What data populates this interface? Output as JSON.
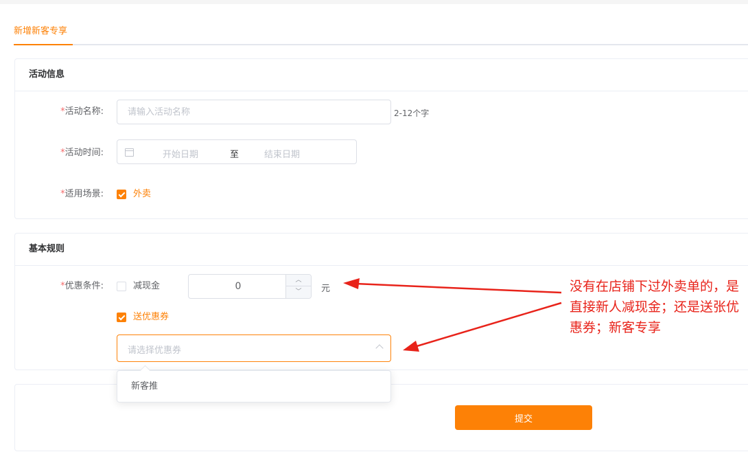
{
  "tabs": {
    "active_label": "新增新客专享"
  },
  "section_activity": {
    "title": "活动信息",
    "name_field": {
      "required_mark": "*",
      "label": "活动名称:",
      "placeholder": "请输入活动名称",
      "hint": "2-12个字"
    },
    "time_field": {
      "required_mark": "*",
      "label": "活动时间:",
      "start_placeholder": "开始日期",
      "separator": "至",
      "end_placeholder": "结束日期"
    },
    "scene_field": {
      "required_mark": "*",
      "label": "适用场景:",
      "option_label": "外卖",
      "checked": true
    }
  },
  "section_rules": {
    "title": "基本规则",
    "discount_field": {
      "required_mark": "*",
      "label": "优惠条件:",
      "cash_option": {
        "label": "减现金",
        "checked": false
      },
      "cash_value": "0",
      "unit": "元",
      "coupon_option": {
        "label": "送优惠券",
        "checked": true
      },
      "coupon_select_placeholder": "请选择优惠券",
      "coupon_options": [
        "新客推"
      ]
    }
  },
  "actions": {
    "submit_label": "提交"
  },
  "annotation": {
    "text": "没有在店铺下过外卖单的，是直接新人减现金；还是送张优惠券；新客专享",
    "color": "#e8231a"
  },
  "colors": {
    "accent": "#fd8106",
    "required": "#f56c6c"
  }
}
